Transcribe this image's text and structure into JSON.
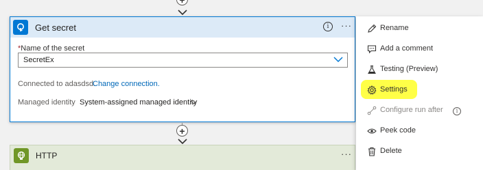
{
  "get_secret_card": {
    "title": "Get secret",
    "info_glyph": "i",
    "more_glyph": "···",
    "name_label_required": "*",
    "name_label": "Name of the secret",
    "name_value": "SecretEx",
    "connected_text": "Connected to adasdsd.",
    "change_connection": "Change connection.",
    "managed_identity_label": "Managed identity",
    "managed_identity_value": "System-assigned managed identity"
  },
  "http_card": {
    "title": "HTTP",
    "more_glyph": "···"
  },
  "context_menu": {
    "items": [
      {
        "label": "Rename",
        "icon": "pencil-icon"
      },
      {
        "label": "Add a comment",
        "icon": "comment-icon"
      },
      {
        "label": "Testing (Preview)",
        "icon": "flask-icon"
      },
      {
        "label": "Settings",
        "icon": "gear-icon",
        "highlighted": true
      },
      {
        "label": "Configure run after",
        "icon": "run-after-icon",
        "disabled": true
      },
      {
        "label": "Peek code",
        "icon": "eye-icon"
      },
      {
        "label": "Delete",
        "icon": "trash-icon"
      }
    ],
    "run_after_info_glyph": "i"
  },
  "colors": {
    "accent": "#0078d4",
    "card_header": "#dceaf7",
    "http_accent": "#709727",
    "highlight": "#ffff33"
  }
}
